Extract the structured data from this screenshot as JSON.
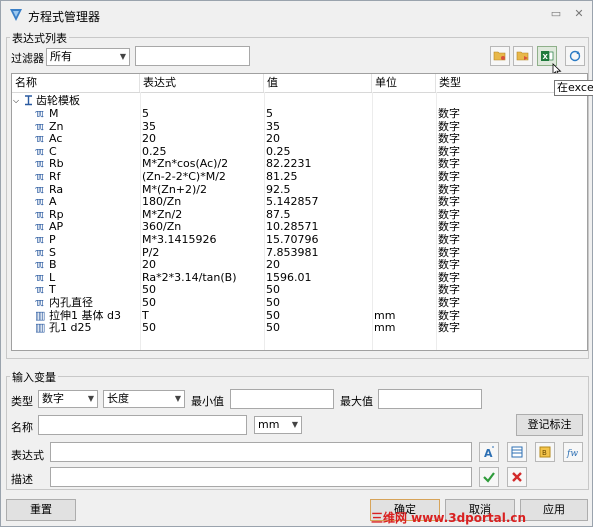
{
  "window": {
    "title": "方程式管理器"
  },
  "expr_list": {
    "group_label": "表达式列表",
    "filter_label": "过滤器",
    "filter_value": "所有",
    "filter_text": ""
  },
  "tooltip": "在excel中",
  "table": {
    "headers": [
      "名称",
      "表达式",
      "值",
      "单位",
      "类型"
    ],
    "group_name": "齿轮模板",
    "rows": [
      {
        "name": "M",
        "expr": "5",
        "value": "5",
        "unit": "",
        "type": "数字"
      },
      {
        "name": "Zn",
        "expr": "35",
        "value": "35",
        "unit": "",
        "type": "数字"
      },
      {
        "name": "Ac",
        "expr": "20",
        "value": "20",
        "unit": "",
        "type": "数字"
      },
      {
        "name": "C",
        "expr": "0.25",
        "value": "0.25",
        "unit": "",
        "type": "数字"
      },
      {
        "name": "Rb",
        "expr": "M*Zn*cos(Ac)/2",
        "value": "82.2231",
        "unit": "",
        "type": "数字"
      },
      {
        "name": "Rf",
        "expr": "(Zn-2-2*C)*M/2",
        "value": "81.25",
        "unit": "",
        "type": "数字"
      },
      {
        "name": "Ra",
        "expr": "M*(Zn+2)/2",
        "value": "92.5",
        "unit": "",
        "type": "数字"
      },
      {
        "name": "A",
        "expr": "180/Zn",
        "value": "5.142857",
        "unit": "",
        "type": "数字"
      },
      {
        "name": "Rp",
        "expr": "M*Zn/2",
        "value": "87.5",
        "unit": "",
        "type": "数字"
      },
      {
        "name": "AP",
        "expr": "360/Zn",
        "value": "10.28571",
        "unit": "",
        "type": "数字"
      },
      {
        "name": "P",
        "expr": "M*3.1415926",
        "value": "15.70796",
        "unit": "",
        "type": "数字"
      },
      {
        "name": "S",
        "expr": "P/2",
        "value": "7.853981",
        "unit": "",
        "type": "数字"
      },
      {
        "name": "B",
        "expr": "20",
        "value": "20",
        "unit": "",
        "type": "数字"
      },
      {
        "name": "L",
        "expr": "Ra*2*3.14/tan(B)",
        "value": "1596.01",
        "unit": "",
        "type": "数字"
      },
      {
        "name": "T",
        "expr": "50",
        "value": "50",
        "unit": "",
        "type": "数字"
      },
      {
        "name": "内孔直径",
        "expr": "50",
        "value": "50",
        "unit": "",
        "type": "数字"
      }
    ],
    "extra_rows": [
      {
        "name": "拉伸1 基体 d3",
        "expr": "T",
        "value": "50",
        "unit": "mm",
        "type": "数字"
      },
      {
        "name": "孔1 d25",
        "expr": "50",
        "value": "50",
        "unit": "mm",
        "type": "数字"
      }
    ]
  },
  "input_var": {
    "group_label": "输入变量",
    "type_label": "类型",
    "type_value": "数字",
    "subtype_value": "长度",
    "min_label": "最小值",
    "max_label": "最大值",
    "name_label": "名称",
    "unit_value": "mm",
    "register_label": "登记标注",
    "expr_label": "表达式",
    "desc_label": "描述"
  },
  "footer": {
    "reset": "重置",
    "ok": "确定",
    "cancel": "取消",
    "apply": "应用"
  },
  "watermark": "三维网 www.3dportal.cn"
}
